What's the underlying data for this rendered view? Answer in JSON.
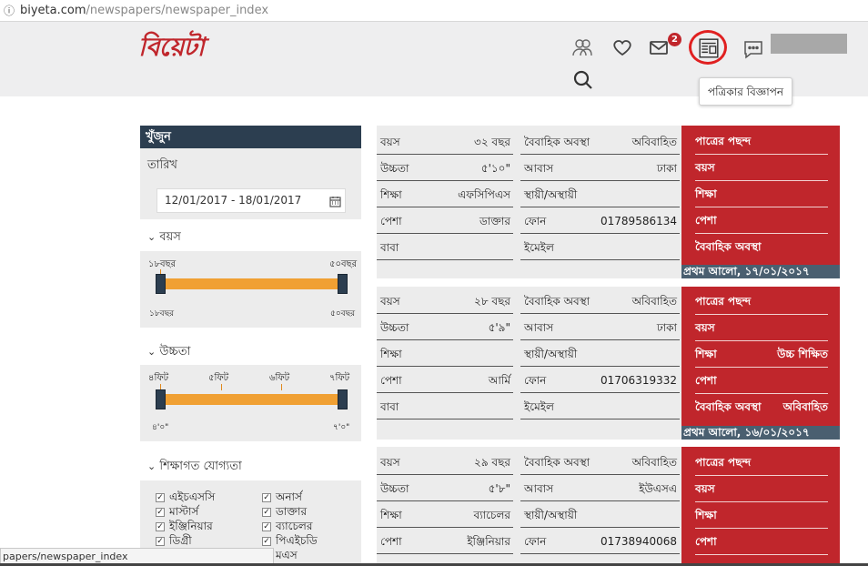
{
  "browser": {
    "url_host": "biyeta.com",
    "url_path": "/newspapers/newspaper_index",
    "status_url": "papers/newspaper_index"
  },
  "header": {
    "logo": "বিয়েটা",
    "mail_badge": "2",
    "tooltip": "পত্রিকার বিজ্ঞাপন",
    "accent_color": "#c0262c"
  },
  "sidebar": {
    "title": "খুঁজুন",
    "date_label": "তারিখ",
    "date_value": "12/01/2017 - 18/01/2017",
    "age": {
      "label": "বয়স",
      "min_label": "১৮বছর",
      "max_label": "৫০বছর",
      "min_bottom": "১৮বছর",
      "max_bottom": "৫০বছর"
    },
    "height": {
      "label": "উচ্চতা",
      "ticks": [
        "৪ফিট",
        "৫ফিট",
        "৬ফিট",
        "৭ফিট"
      ],
      "min_bottom": "৪'০\"",
      "max_bottom": "৭'০\""
    },
    "education": {
      "label": "শিক্ষাগত যোগ্যতা",
      "left": [
        "এইচএসসি",
        "মাস্টার্স",
        "ইঞ্জিনিয়ার",
        "ডিগ্রী"
      ],
      "right": [
        "অনার্স",
        "ডাক্তার",
        "ব্যাচেলর",
        "পিএইচডি"
      ],
      "partial": "মএস"
    }
  },
  "cards": [
    {
      "rows": [
        {
          "k1": "বয়স",
          "v1": "৩২ বছর",
          "k2": "বৈবাহিক অবস্থা",
          "v2": "অবিবাহিত"
        },
        {
          "k1": "উচ্চতা",
          "v1": "৫'১০\"",
          "k2": "আবাস",
          "v2": "ঢাকা"
        },
        {
          "k1": "শিক্ষা",
          "v1": "এফসিপিএস",
          "k2": "স্থায়ী/অস্থায়ী",
          "v2": ""
        },
        {
          "k1": "পেশা",
          "v1": "ডাক্তার",
          "k2": "ফোন",
          "v2": "01789586134"
        },
        {
          "k1": "বাবা",
          "v1": "",
          "k2": "ইমেইল",
          "v2": ""
        }
      ],
      "prefs": [
        {
          "k": "পাত্রের পছন্দ",
          "v": ""
        },
        {
          "k": "বয়স",
          "v": ""
        },
        {
          "k": "শিক্ষা",
          "v": ""
        },
        {
          "k": "পেশা",
          "v": ""
        },
        {
          "k": "বৈবাহিক অবস্থা",
          "v": ""
        }
      ],
      "footer": "প্রথম আলো, ১৭/০১/২০১৭"
    },
    {
      "rows": [
        {
          "k1": "বয়স",
          "v1": "২৮ বছর",
          "k2": "বৈবাহিক অবস্থা",
          "v2": "অবিবাহিত"
        },
        {
          "k1": "উচ্চতা",
          "v1": "৫'৯\"",
          "k2": "আবাস",
          "v2": "ঢাকা"
        },
        {
          "k1": "শিক্ষা",
          "v1": "",
          "k2": "স্থায়ী/অস্থায়ী",
          "v2": ""
        },
        {
          "k1": "পেশা",
          "v1": "আর্মি",
          "k2": "ফোন",
          "v2": "01706319332"
        },
        {
          "k1": "বাবা",
          "v1": "",
          "k2": "ইমেইল",
          "v2": ""
        }
      ],
      "prefs": [
        {
          "k": "পাত্রের পছন্দ",
          "v": ""
        },
        {
          "k": "বয়স",
          "v": ""
        },
        {
          "k": "শিক্ষা",
          "v": "উচ্চ শিক্ষিত"
        },
        {
          "k": "পেশা",
          "v": ""
        },
        {
          "k": "বৈবাহিক অবস্থা",
          "v": "অবিবাহিত"
        }
      ],
      "footer": "প্রথম আলো, ১৬/০১/২০১৭"
    },
    {
      "rows": [
        {
          "k1": "বয়স",
          "v1": "২৯ বছর",
          "k2": "বৈবাহিক অবস্থা",
          "v2": "অবিবাহিত"
        },
        {
          "k1": "উচ্চতা",
          "v1": "৫'৮\"",
          "k2": "আবাস",
          "v2": "ইউএসএ"
        },
        {
          "k1": "শিক্ষা",
          "v1": "ব্যাচেলর",
          "k2": "স্থায়ী/অস্থায়ী",
          "v2": ""
        },
        {
          "k1": "পেশা",
          "v1": "ইঞ্জিনিয়ার",
          "k2": "ফোন",
          "v2": "01738940068"
        }
      ],
      "prefs": [
        {
          "k": "পাত্রের পছন্দ",
          "v": ""
        },
        {
          "k": "বয়স",
          "v": ""
        },
        {
          "k": "শিক্ষা",
          "v": ""
        },
        {
          "k": "পেশা",
          "v": ""
        }
      ],
      "footer": ""
    }
  ]
}
